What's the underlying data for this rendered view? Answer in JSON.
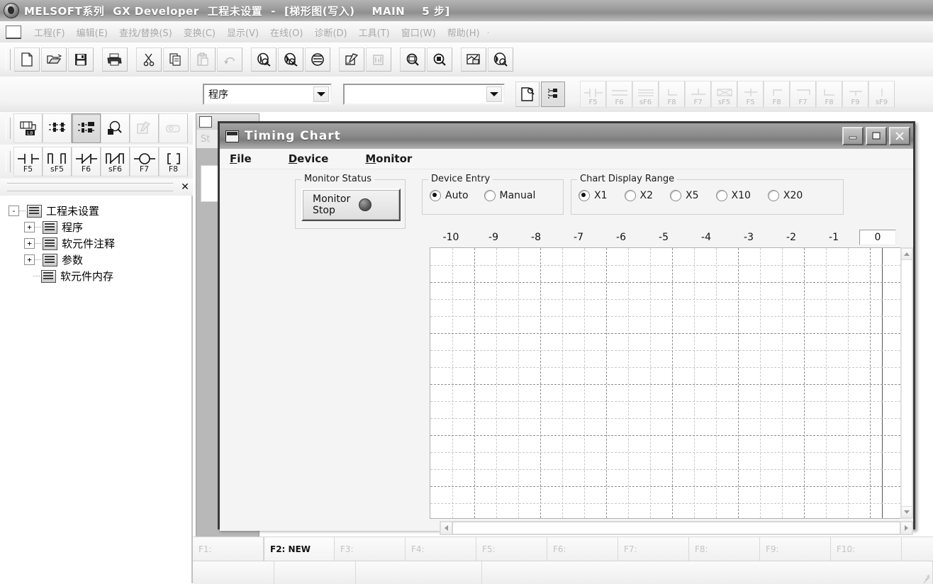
{
  "window": {
    "title": "MELSOFT系列 GX Developer 工程未设置 - [梯形图(写入)",
    "title_main": "MELSOFT系列",
    "title_app": "GX Developer",
    "title_project": "工程未设置",
    "title_dash": "-",
    "title_bracket": "[梯形图(写入)",
    "title_program": "MAIN",
    "title_steps": "5 步]",
    "app_icon": "melsoft-globe-icon"
  },
  "menubar": {
    "doc_icon": "document-icon",
    "items": [
      {
        "label": "工程(F)",
        "name": "menu-project"
      },
      {
        "label": "编辑(E)",
        "name": "menu-edit"
      },
      {
        "label": "查找/替换(S)",
        "name": "menu-find-replace"
      },
      {
        "label": "变换(C)",
        "name": "menu-convert"
      },
      {
        "label": "显示(V)",
        "name": "menu-view"
      },
      {
        "label": "在线(O)",
        "name": "menu-online"
      },
      {
        "label": "诊断(D)",
        "name": "menu-diagnostics"
      },
      {
        "label": "工具(T)",
        "name": "menu-tools"
      },
      {
        "label": "窗口(W)",
        "name": "menu-window"
      },
      {
        "label": "帮助(H)",
        "name": "menu-help"
      }
    ],
    "trailing_dot": "·"
  },
  "toolbar_main": {
    "buttons": [
      {
        "icon": "new-file-icon"
      },
      {
        "icon": "open-folder-icon"
      },
      {
        "icon": "save-disk-icon"
      },
      {
        "sep": true
      },
      {
        "icon": "print-icon"
      },
      {
        "sep": true
      },
      {
        "icon": "cut-scissors-icon"
      },
      {
        "icon": "copy-icon"
      },
      {
        "icon": "paste-icon"
      },
      {
        "icon": "undo-icon"
      },
      {
        "sep": true
      },
      {
        "icon": "find-device-icon"
      },
      {
        "icon": "find-instruction-icon"
      },
      {
        "icon": "find-contact-icon"
      },
      {
        "sep": true
      },
      {
        "icon": "convert-icon"
      },
      {
        "icon": "convert-all-icon"
      },
      {
        "sep": true
      },
      {
        "icon": "zoom-out-icon"
      },
      {
        "icon": "zoom-in-icon"
      },
      {
        "sep": true
      },
      {
        "icon": "comment-display-icon"
      },
      {
        "icon": "monitor-mode-icon"
      }
    ]
  },
  "toolbar_combo": {
    "mode_combo_value": "程序",
    "mode_combo_placeholder": "",
    "name_combo_value": "",
    "name_combo_placeholder": "",
    "new_doc_icon": "new-doc-search-icon",
    "tree_icon": "project-tree-icon",
    "fkeys": [
      {
        "label": "F5",
        "icon": "contact-normally-open-icon"
      },
      {
        "label": "F6",
        "icon": "double-line-icon"
      },
      {
        "label": "sF6",
        "icon": "triple-line-icon"
      },
      {
        "label": "F8",
        "icon": "corner-line-icon"
      },
      {
        "label": "F7",
        "icon": "vertical-tee-icon"
      },
      {
        "label": "sF5",
        "icon": "crossed-box-icon"
      },
      {
        "label": "F5",
        "icon": "plus-line-icon"
      },
      {
        "label": "F8",
        "icon": "top-right-corner-icon"
      },
      {
        "label": "F7",
        "icon": "top-bar-icon"
      },
      {
        "label": "F8",
        "icon": "bottom-corner-icon"
      },
      {
        "label": "F9",
        "icon": "equal-line-icon"
      },
      {
        "label": "sF9",
        "icon": "vertical-bar-icon"
      }
    ]
  },
  "toolbar_left_row1": [
    {
      "icon": "device-memory-icon",
      "name": "tb-device-memory"
    },
    {
      "icon": "ladder-edit-icon",
      "name": "tb-ladder-edit"
    },
    {
      "icon": "ladder-write-icon",
      "name": "tb-ladder-write",
      "pressed": true
    },
    {
      "icon": "device-search-icon",
      "name": "tb-device-search"
    },
    {
      "icon": "edit-pencil-icon",
      "name": "tb-edit-pencil",
      "disabled": true
    },
    {
      "icon": "print-preview-icon",
      "name": "tb-print-preview",
      "disabled": true
    }
  ],
  "toolbar_left_row2": [
    {
      "label": "F5",
      "icon": "normally-open-contact-icon"
    },
    {
      "label": "sF5",
      "icon": "parallel-open-contact-icon"
    },
    {
      "label": "F6",
      "icon": "normally-closed-contact-icon"
    },
    {
      "label": "sF6",
      "icon": "parallel-closed-contact-icon"
    },
    {
      "label": "F7",
      "icon": "coil-icon"
    },
    {
      "label": "F8",
      "icon": "application-instruction-icon"
    }
  ],
  "tree_panel": {
    "close_icon": "close-x-icon",
    "nodes": [
      {
        "label": "工程未设置",
        "expander": "-",
        "icon": "project-root-icon",
        "level": 0,
        "name": "tree-node-project-root"
      },
      {
        "label": "程序",
        "expander": "+",
        "icon": "program-folder-icon",
        "level": 1,
        "name": "tree-node-program"
      },
      {
        "label": "软元件注释",
        "expander": "+",
        "icon": "device-comment-icon",
        "level": 1,
        "name": "tree-node-device-comment"
      },
      {
        "label": "参数",
        "expander": "+",
        "icon": "parameter-icon",
        "level": 1,
        "name": "tree-node-parameter"
      },
      {
        "label": "软元件内存",
        "expander": "",
        "icon": "device-memory-icon",
        "level": 1,
        "name": "tree-node-device-memory"
      }
    ]
  },
  "mdi_child": {
    "tab_label": "St",
    "icon": "melsoft-window-icon"
  },
  "dialog": {
    "title": "Timing Chart",
    "icon": "timing-chart-icon",
    "minimize_label": "–",
    "maximize_label": "□",
    "close_label": "✕",
    "menu": [
      {
        "label": "File",
        "mnemonic": "F",
        "name": "dialog-menu-file"
      },
      {
        "label": "Device",
        "mnemonic": "D",
        "name": "dialog-menu-device"
      },
      {
        "label": "Monitor",
        "mnemonic": "M",
        "name": "dialog-menu-monitor"
      }
    ],
    "monitor_status": {
      "legend": "Monitor Status",
      "button_line1": "Monitor",
      "button_line2": "Stop",
      "led": "status-led-off"
    },
    "device_entry": {
      "legend": "Device Entry",
      "options": [
        {
          "label": "Auto",
          "selected": true
        },
        {
          "label": "Manual",
          "selected": false
        }
      ]
    },
    "chart_display_range": {
      "legend": "Chart Display Range",
      "options": [
        {
          "label": "X1",
          "selected": true
        },
        {
          "label": "X2",
          "selected": false
        },
        {
          "label": "X5",
          "selected": false
        },
        {
          "label": "X10",
          "selected": false
        },
        {
          "label": "X20",
          "selected": false
        }
      ]
    },
    "ruler": {
      "ticks": [
        "-10",
        "-9",
        "-8",
        "-7",
        "-6",
        "-5",
        "-4",
        "-3",
        "-2",
        "-1"
      ],
      "cursor_value": "0"
    },
    "scrollbars": {
      "v_up_icon": "scroll-up-arrow-icon",
      "v_down_icon": "scroll-down-arrow-icon",
      "h_left_icon": "scroll-left-arrow-icon",
      "h_right_icon": "scroll-right-arrow-icon"
    }
  },
  "chart_data": {
    "type": "line",
    "title": "Timing Chart",
    "xlabel": "",
    "ylabel": "",
    "x_tick_labels": [
      "-10",
      "-9",
      "-8",
      "-7",
      "-6",
      "-5",
      "-4",
      "-3",
      "-2",
      "-1",
      "0"
    ],
    "xlim": [
      -10,
      0
    ],
    "grid": true,
    "legend": "none",
    "series": [],
    "note": "Empty timing chart — no device waveforms plotted; grid only",
    "rows": 16,
    "columns": 11,
    "display_range": "X1",
    "monitor_state": "Monitor Stop"
  },
  "fkey_bar": {
    "cells": [
      {
        "label": "F1:",
        "active": false
      },
      {
        "label": "F2: NEW",
        "active": true
      },
      {
        "label": "F3:",
        "active": false
      },
      {
        "label": "F4:",
        "active": false
      },
      {
        "label": "F5:",
        "active": false
      },
      {
        "label": "F6:",
        "active": false
      },
      {
        "label": "F7:",
        "active": false
      },
      {
        "label": "F8:",
        "active": false
      },
      {
        "label": "F9:",
        "active": false
      },
      {
        "label": "F10:",
        "active": false
      }
    ]
  },
  "statusbar": {
    "cells": [
      "",
      "",
      "",
      ""
    ],
    "resize_grip": "resize-grip-icon"
  },
  "colors": {
    "titlebar_gradient_top": "#b4b4b4",
    "titlebar_gradient_bottom": "#8f8f8f",
    "dialog_border": "#3a3a3a",
    "dialog_face": "#f4f4f4",
    "chart_bg": "#ffffff",
    "grid_major": "#8e8e8e",
    "grid_minor": "#c9c9c9",
    "mdi_background": "#b8b8b8"
  }
}
